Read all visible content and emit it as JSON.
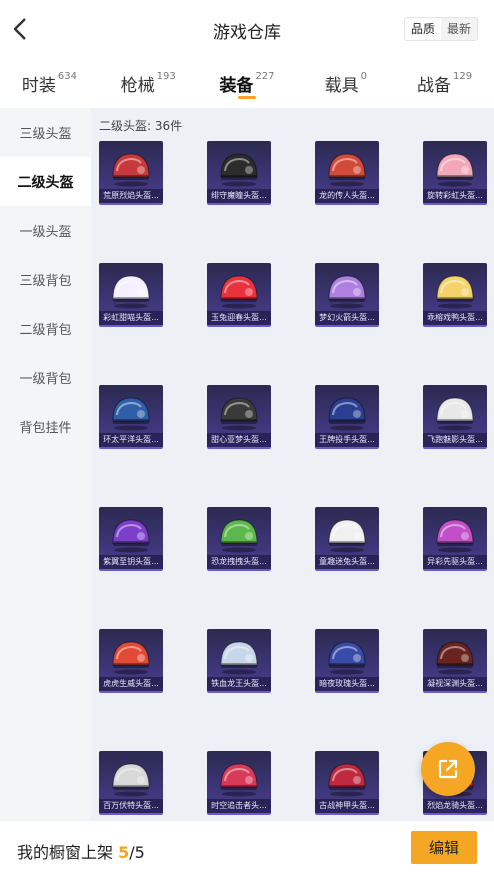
{
  "header": {
    "title": "游戏仓库",
    "back_icon": "chevron-left-icon",
    "sort_options": [
      "品质",
      "最新"
    ],
    "sort_selected": "品质"
  },
  "tabs": [
    {
      "label": "时装",
      "count": "634"
    },
    {
      "label": "枪械",
      "count": "193"
    },
    {
      "label": "装备",
      "count": "227",
      "active": true
    },
    {
      "label": "载具",
      "count": "0"
    },
    {
      "label": "战备",
      "count": "129"
    }
  ],
  "sidebar": {
    "items": [
      {
        "label": "三级头盔"
      },
      {
        "label": "二级头盔",
        "active": true
      },
      {
        "label": "一级头盔"
      },
      {
        "label": "三级背包"
      },
      {
        "label": "二级背包"
      },
      {
        "label": "一级背包"
      },
      {
        "label": "背包挂件"
      }
    ]
  },
  "content": {
    "section_title": "二级头盔: 36件",
    "items": [
      {
        "name": "荒原烈焰头盔...",
        "color": "#c8393b"
      },
      {
        "name": "绯守魔瞳头盔...",
        "color": "#2c2c2c"
      },
      {
        "name": "龙的传人头盔...",
        "color": "#d24a3a"
      },
      {
        "name": "旋转彩虹头盔...",
        "color": "#f2a8b8"
      },
      {
        "name": "彩虹甜喵头盔...",
        "color": "#f4f0ff"
      },
      {
        "name": "玉兔迎春头盔...",
        "color": "#e8323e"
      },
      {
        "name": "梦幻火箭头盔...",
        "color": "#b080e0"
      },
      {
        "name": "乖榕戏鸭头盔...",
        "color": "#f3d36a"
      },
      {
        "name": "环太平洋头盔...",
        "color": "#2e5fa8"
      },
      {
        "name": "甜心亚梦头盔...",
        "color": "#3a3a3a"
      },
      {
        "name": "王牌投手头盔...",
        "color": "#2a3f8f"
      },
      {
        "name": "飞跑魅影头盔...",
        "color": "#e8e8e8"
      },
      {
        "name": "紫翼至钥头盔...",
        "color": "#7b3fc9"
      },
      {
        "name": "恐龙拽拽头盔...",
        "color": "#5cb84a"
      },
      {
        "name": "童趣迷兔头盔...",
        "color": "#f0f0f0"
      },
      {
        "name": "异彩先驱头盔...",
        "color": "#c04fc8"
      },
      {
        "name": "虎虎生威头盔...",
        "color": "#e24a36"
      },
      {
        "name": "铁血龙王头盔...",
        "color": "#c8d6ea"
      },
      {
        "name": "暗夜玫瑰头盔...",
        "color": "#3a4aa8"
      },
      {
        "name": "凝视深渊头盔...",
        "color": "#6a2420"
      },
      {
        "name": "百万伏特头盔...",
        "color": "#d8d8d8"
      },
      {
        "name": "时空追击者头...",
        "color": "#d83a5a"
      },
      {
        "name": "古战神甲头盔...",
        "color": "#c02a40"
      },
      {
        "name": "烈焰龙骑头盔...",
        "color": "#b83030"
      }
    ]
  },
  "fab": {
    "icon": "share-external-icon"
  },
  "bottom": {
    "prefix": "我的橱窗上架 ",
    "current": "5",
    "total": "/5",
    "edit_label": "编辑"
  },
  "colors": {
    "accent": "#f5a623",
    "card_bg": "#3b3474"
  }
}
